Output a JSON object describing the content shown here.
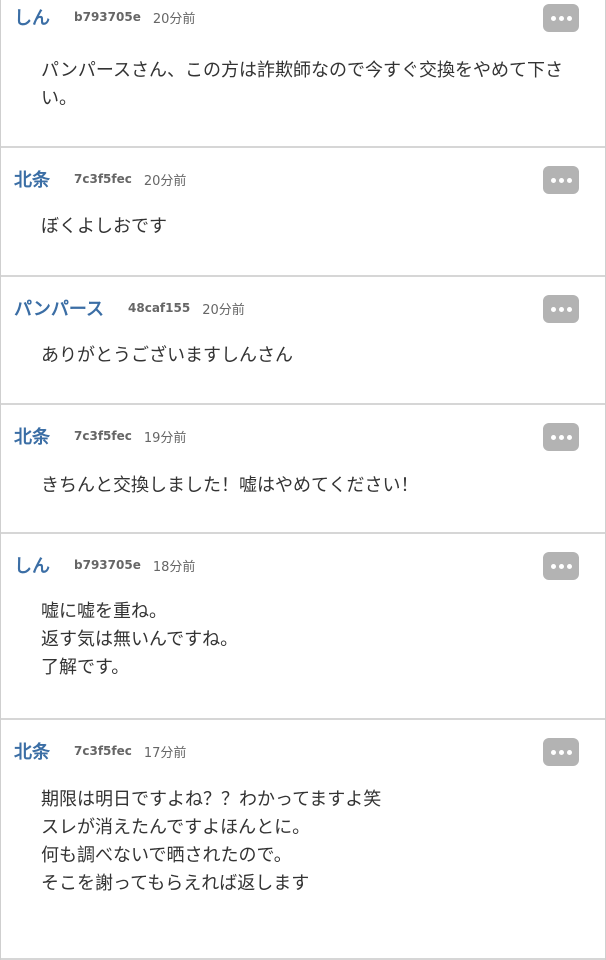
{
  "posts": [
    {
      "author": "しん",
      "uid": "b793705e",
      "time": "20分前",
      "lines": [
        "パンパースさん、この方は詐欺師なので今すぐ交換をやめて下さい。"
      ]
    },
    {
      "author": "北条",
      "uid": "7c3f5fec",
      "time": "20分前",
      "lines": [
        "ぼくよしおです"
      ]
    },
    {
      "author": "パンパース",
      "uid": "48caf155",
      "time": "20分前",
      "lines": [
        "ありがとうございますしんさん"
      ]
    },
    {
      "author": "北条",
      "uid": "7c3f5fec",
      "time": "19分前",
      "lines": [
        "きちんと交換しました！嘘はやめてください！"
      ]
    },
    {
      "author": "しん",
      "uid": "b793705e",
      "time": "18分前",
      "lines": [
        "嘘に嘘を重ね。",
        "返す気は無いんですね。",
        "了解です。"
      ]
    },
    {
      "author": "北条",
      "uid": "7c3f5fec",
      "time": "17分前",
      "lines": [
        "期限は明日ですよね？？わかってますよ笑",
        "スレが消えたんですよほんとに。",
        "何も調べないで晒されたので。",
        "そこを謝ってもらえれば返します"
      ]
    }
  ],
  "colors": {
    "author": "#3b6ea5",
    "meta": "#666666",
    "text": "#333333",
    "menu_button": "#b3b3b3",
    "divider": "#d6d6d6"
  },
  "icons": {
    "post_menu": "more-dots-icon"
  }
}
